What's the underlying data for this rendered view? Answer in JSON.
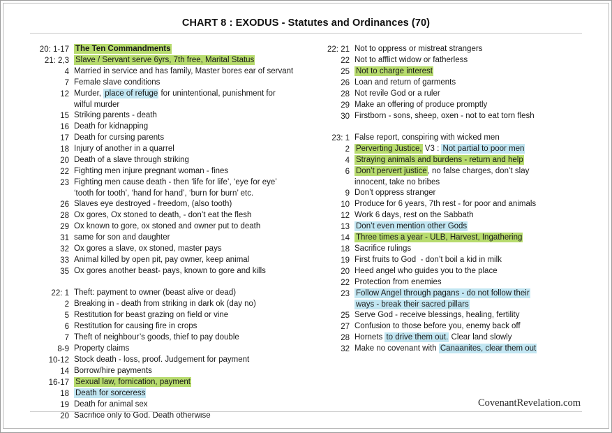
{
  "header": {
    "title": "CHART 8 : EXODUS - Statutes and Ordinances  (70)"
  },
  "footer": {
    "site": "CovenantRevelation.com"
  },
  "colors": {
    "highlight_green": "#b7db6e",
    "highlight_blue": "#c2e6f2",
    "text": "#1a1a1a",
    "rule": "#c9c9c9",
    "border": "#9a9a9a"
  },
  "columns": {
    "left": [
      {
        "num": "20: 1-17",
        "bold": true,
        "parts": [
          {
            "t": "The Ten Commandments",
            "h": "green"
          }
        ]
      },
      {
        "num": "21: 2,3",
        "parts": [
          {
            "t": "Slave / Servant serve 6yrs, 7th free, Marital Status",
            "h": "green"
          }
        ]
      },
      {
        "num": "4",
        "parts": [
          {
            "t": "Married in service and has family, Master bores ear of servant",
            "h": "none"
          }
        ]
      },
      {
        "num": "7",
        "parts": [
          {
            "t": "Female slave conditions",
            "h": "none"
          }
        ]
      },
      {
        "num": "12",
        "parts": [
          {
            "t": "Murder, ",
            "h": "none"
          },
          {
            "t": "place of refuge",
            "h": "blue"
          },
          {
            "t": " for unintentional, punishment for",
            "h": "none"
          }
        ]
      },
      {
        "num": "",
        "cont": true,
        "parts": [
          {
            "t": "wilful murder",
            "h": "none"
          }
        ]
      },
      {
        "num": "15",
        "parts": [
          {
            "t": "Striking parents - death",
            "h": "none"
          }
        ]
      },
      {
        "num": "16",
        "parts": [
          {
            "t": "Death for kidnapping",
            "h": "none"
          }
        ]
      },
      {
        "num": "17",
        "parts": [
          {
            "t": "Death for cursing parents",
            "h": "none"
          }
        ]
      },
      {
        "num": "18",
        "parts": [
          {
            "t": "Injury of another in a quarrel",
            "h": "none"
          }
        ]
      },
      {
        "num": "20",
        "parts": [
          {
            "t": "Death of a slave through striking",
            "h": "none"
          }
        ]
      },
      {
        "num": "22",
        "parts": [
          {
            "t": "Fighting men injure pregnant woman - fines",
            "h": "none"
          }
        ]
      },
      {
        "num": "23",
        "parts": [
          {
            "t": "Fighting men cause death - then ‘life for life’, ‘eye for eye’",
            "h": "none"
          }
        ]
      },
      {
        "num": "",
        "cont": true,
        "parts": [
          {
            "t": "‘tooth for tooth’, ‘hand for hand’, ‘burn for burn’ etc.",
            "h": "none"
          }
        ]
      },
      {
        "num": "26",
        "parts": [
          {
            "t": "Slaves eye destroyed - freedom, (also tooth)",
            "h": "none"
          }
        ]
      },
      {
        "num": "28",
        "parts": [
          {
            "t": "Ox gores, Ox stoned to death, - don’t eat the flesh",
            "h": "none"
          }
        ]
      },
      {
        "num": "29",
        "parts": [
          {
            "t": "Ox known to gore, ox stoned and owner put to death",
            "h": "none"
          }
        ]
      },
      {
        "num": "31",
        "parts": [
          {
            "t": "same for son and daughter",
            "h": "none"
          }
        ]
      },
      {
        "num": "32",
        "parts": [
          {
            "t": "Ox gores a slave, ox stoned, master pays",
            "h": "none"
          }
        ]
      },
      {
        "num": "33",
        "parts": [
          {
            "t": "Animal killed by open pit, pay owner, keep animal",
            "h": "none"
          }
        ]
      },
      {
        "num": "35",
        "parts": [
          {
            "t": "Ox gores another beast- pays, known to gore and kills",
            "h": "none"
          }
        ]
      },
      {
        "num": "22: 1",
        "gap": true,
        "parts": [
          {
            "t": "Theft: payment to owner (beast alive or dead)",
            "h": "none"
          }
        ]
      },
      {
        "num": "2",
        "parts": [
          {
            "t": "Breaking in - death from striking in dark ok (day no)",
            "h": "none"
          }
        ]
      },
      {
        "num": "5",
        "parts": [
          {
            "t": "Restitution for beast grazing on field or vine",
            "h": "none"
          }
        ]
      },
      {
        "num": "6",
        "parts": [
          {
            "t": "Restitution for causing fire in crops",
            "h": "none"
          }
        ]
      },
      {
        "num": "7",
        "parts": [
          {
            "t": "Theft of neighbour’s goods, thief to pay double",
            "h": "none"
          }
        ]
      },
      {
        "num": "8-9",
        "parts": [
          {
            "t": "Property claims",
            "h": "none"
          }
        ]
      },
      {
        "num": "10-12",
        "parts": [
          {
            "t": "Stock death - loss, proof. Judgement for payment",
            "h": "none"
          }
        ]
      },
      {
        "num": "14",
        "parts": [
          {
            "t": "Borrow/hire payments",
            "h": "none"
          }
        ]
      },
      {
        "num": "16-17",
        "parts": [
          {
            "t": "Sexual law, fornication, payment",
            "h": "green"
          }
        ]
      },
      {
        "num": "18",
        "parts": [
          {
            "t": "Death for sorceress",
            "h": "blue"
          }
        ]
      },
      {
        "num": "19",
        "parts": [
          {
            "t": "Death for animal sex",
            "h": "none"
          }
        ]
      },
      {
        "num": "20",
        "parts": [
          {
            "t": "Sacrifice only to God. Death otherwise",
            "h": "none"
          }
        ]
      }
    ],
    "right": [
      {
        "num": "22: 21",
        "parts": [
          {
            "t": "Not to oppress or mistreat strangers",
            "h": "none"
          }
        ]
      },
      {
        "num": "22",
        "parts": [
          {
            "t": "Not to afflict widow or fatherless",
            "h": "none"
          }
        ]
      },
      {
        "num": "25",
        "parts": [
          {
            "t": "Not to charge interest",
            "h": "green"
          }
        ]
      },
      {
        "num": "26",
        "parts": [
          {
            "t": "Loan and return of garments",
            "h": "none"
          }
        ]
      },
      {
        "num": "28",
        "parts": [
          {
            "t": "Not revile God or a ruler",
            "h": "none"
          }
        ]
      },
      {
        "num": "29",
        "parts": [
          {
            "t": "Make an offering of produce promptly",
            "h": "none"
          }
        ]
      },
      {
        "num": "30",
        "parts": [
          {
            "t": "Firstborn - sons, sheep, oxen - not to eat torn flesh",
            "h": "none"
          }
        ]
      },
      {
        "num": "23: 1",
        "gap": true,
        "parts": [
          {
            "t": "False report, conspiring with wicked men",
            "h": "none"
          }
        ]
      },
      {
        "num": "2",
        "parts": [
          {
            "t": "Perverting Justice,",
            "h": "green"
          },
          {
            "t": " V3 : ",
            "h": "none"
          },
          {
            "t": "Not partial to poor men",
            "h": "blue"
          }
        ]
      },
      {
        "num": "4",
        "parts": [
          {
            "t": "Straying animals and burdens - return and help",
            "h": "green"
          }
        ]
      },
      {
        "num": "6",
        "parts": [
          {
            "t": "Don’t pervert justice",
            "h": "green"
          },
          {
            "t": ", no false charges, don’t slay",
            "h": "none"
          }
        ]
      },
      {
        "num": "",
        "cont": true,
        "parts": [
          {
            "t": "innocent, take no bribes",
            "h": "none"
          }
        ]
      },
      {
        "num": "9",
        "parts": [
          {
            "t": "Don’t oppress stranger",
            "h": "none"
          }
        ]
      },
      {
        "num": "10",
        "parts": [
          {
            "t": "Produce for 6 years, 7th rest - for poor and animals",
            "h": "none"
          }
        ]
      },
      {
        "num": "12",
        "parts": [
          {
            "t": "Work 6 days, rest on the Sabbath",
            "h": "none"
          }
        ]
      },
      {
        "num": "13",
        "parts": [
          {
            "t": "Don’t even mention other Gods",
            "h": "blue"
          }
        ]
      },
      {
        "num": "14",
        "parts": [
          {
            "t": "Three times a year - ULB, Harvest, Ingathering",
            "h": "green"
          }
        ]
      },
      {
        "num": "18",
        "parts": [
          {
            "t": "Sacrifice rulings",
            "h": "none"
          }
        ]
      },
      {
        "num": "19",
        "parts": [
          {
            "t": "First fruits to God  - don’t boil a kid in milk",
            "h": "none"
          }
        ]
      },
      {
        "num": "20",
        "parts": [
          {
            "t": "Heed angel who guides you to the place",
            "h": "none"
          }
        ]
      },
      {
        "num": "22",
        "parts": [
          {
            "t": "Protection from enemies",
            "h": "none"
          }
        ]
      },
      {
        "num": "23",
        "parts": [
          {
            "t": "Follow Angel through pagans - do not follow their",
            "h": "blue"
          }
        ]
      },
      {
        "num": "",
        "cont": true,
        "parts": [
          {
            "t": "ways - break their sacred pillars",
            "h": "blue"
          }
        ]
      },
      {
        "num": "25",
        "parts": [
          {
            "t": "Serve God - receive blessings, healing, fertility",
            "h": "none"
          }
        ]
      },
      {
        "num": "27",
        "parts": [
          {
            "t": "Confusion to those before you, enemy back off",
            "h": "none"
          }
        ]
      },
      {
        "num": "28",
        "parts": [
          {
            "t": "Hornets ",
            "h": "none"
          },
          {
            "t": "to drive them out.",
            "h": "blue"
          },
          {
            "t": " Clear land slowly",
            "h": "none"
          }
        ]
      },
      {
        "num": "32",
        "parts": [
          {
            "t": "Make no covenant with ",
            "h": "none"
          },
          {
            "t": "Canaanites, clear them out",
            "h": "blue"
          }
        ]
      }
    ]
  }
}
